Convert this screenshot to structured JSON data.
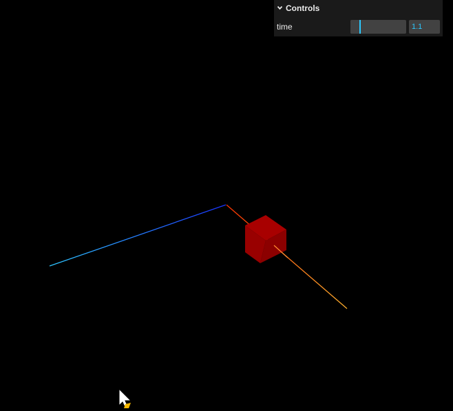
{
  "controls": {
    "title": "Controls",
    "time": {
      "label": "time",
      "value": "1.1",
      "min": 0,
      "max": 10,
      "fraction": 0.17
    }
  },
  "scene": {
    "axis_colors": {
      "x_pos": "#ff9a2e",
      "x_neg": "#ff3300",
      "y_pos": "#b8e020",
      "y_neg": "#33ff00",
      "z_pos": "#2ea6ff",
      "z_neg": "#1a33ff"
    },
    "cube_color": "#990000",
    "cube_shade_dark": "#7a0000",
    "cube_shade_light": "#a80000"
  },
  "icons": {
    "chevron": "chevron-down-icon",
    "cursor": "mouse-cursor-icon"
  }
}
